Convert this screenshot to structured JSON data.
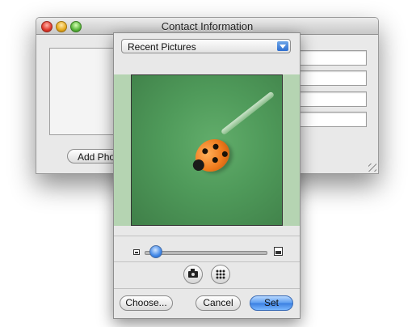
{
  "window": {
    "title": "Contact Information",
    "add_photo_label": "Add Photo..."
  },
  "picture_taker": {
    "source_popup": {
      "selected": "Recent Pictures"
    },
    "image": {
      "subject": "ladybug on a green blade of grass"
    },
    "zoom_level": 0.05,
    "buttons": {
      "choose": "Choose...",
      "cancel": "Cancel",
      "set": "Set"
    },
    "icons": {
      "camera": "camera-icon",
      "grid": "grid-icon"
    }
  },
  "colors": {
    "accent": "#3a7fe0",
    "crop_background": "#b5d4b2"
  }
}
